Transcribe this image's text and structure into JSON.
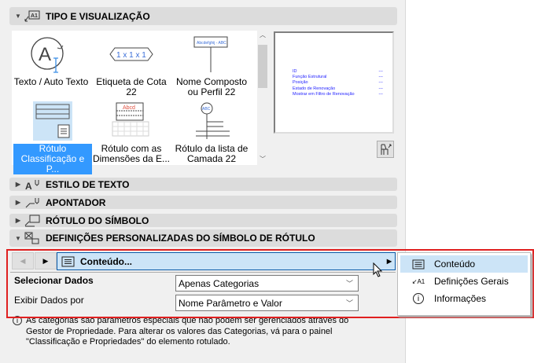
{
  "sections": {
    "tipo": "TIPO E VISUALIZAÇÃO",
    "estilo": "ESTILO DE TEXTO",
    "apontador": "APONTADOR",
    "rotulo_simbolo": "RÓTULO DO SÍMBOLO",
    "definicoes": "DEFINIÇÕES PERSONALIZADAS DO SÍMBOLO DE RÓTULO"
  },
  "items": [
    {
      "label": "Texto / Auto Texto"
    },
    {
      "label": "Etiqueta de Cota 22",
      "thumb": "1 x 1 x 1"
    },
    {
      "label": "Nome Composto ou Perfil 22",
      "thumb": "Abcdefghij - ABC"
    },
    {
      "label": "Rótulo Classificação e P..."
    },
    {
      "label": "Rótulo com as Dimensões da E...",
      "thumb": "Abcd"
    },
    {
      "label": "Rótulo da lista de Camada 22",
      "thumb": "ABC"
    }
  ],
  "preview": [
    {
      "name": "ID",
      "value": "---"
    },
    {
      "name": "Função Estrutural",
      "value": "---"
    },
    {
      "name": "Posição",
      "value": "---"
    },
    {
      "name": "Estado de Renovação",
      "value": "---"
    },
    {
      "name": "Mostrar em Filtro de Renovação",
      "value": "---"
    }
  ],
  "page_selector": "Conteúdo...",
  "fields": [
    {
      "label": "Selecionar Dados",
      "value": "Apenas Categorias"
    },
    {
      "label": "Exibir Dados por",
      "value": "Nome Parâmetro e Valor"
    }
  ],
  "popup": [
    "Conteúdo",
    "Definições Gerais",
    "Informações"
  ],
  "info": "As categorias são parâmetros especiais que não podem ser gerenciados através do Gestor de Propriedade. Para alterar os valores das Categorias, vá para o painel \"Classificação e Propriedades\" do elemento rotulado."
}
